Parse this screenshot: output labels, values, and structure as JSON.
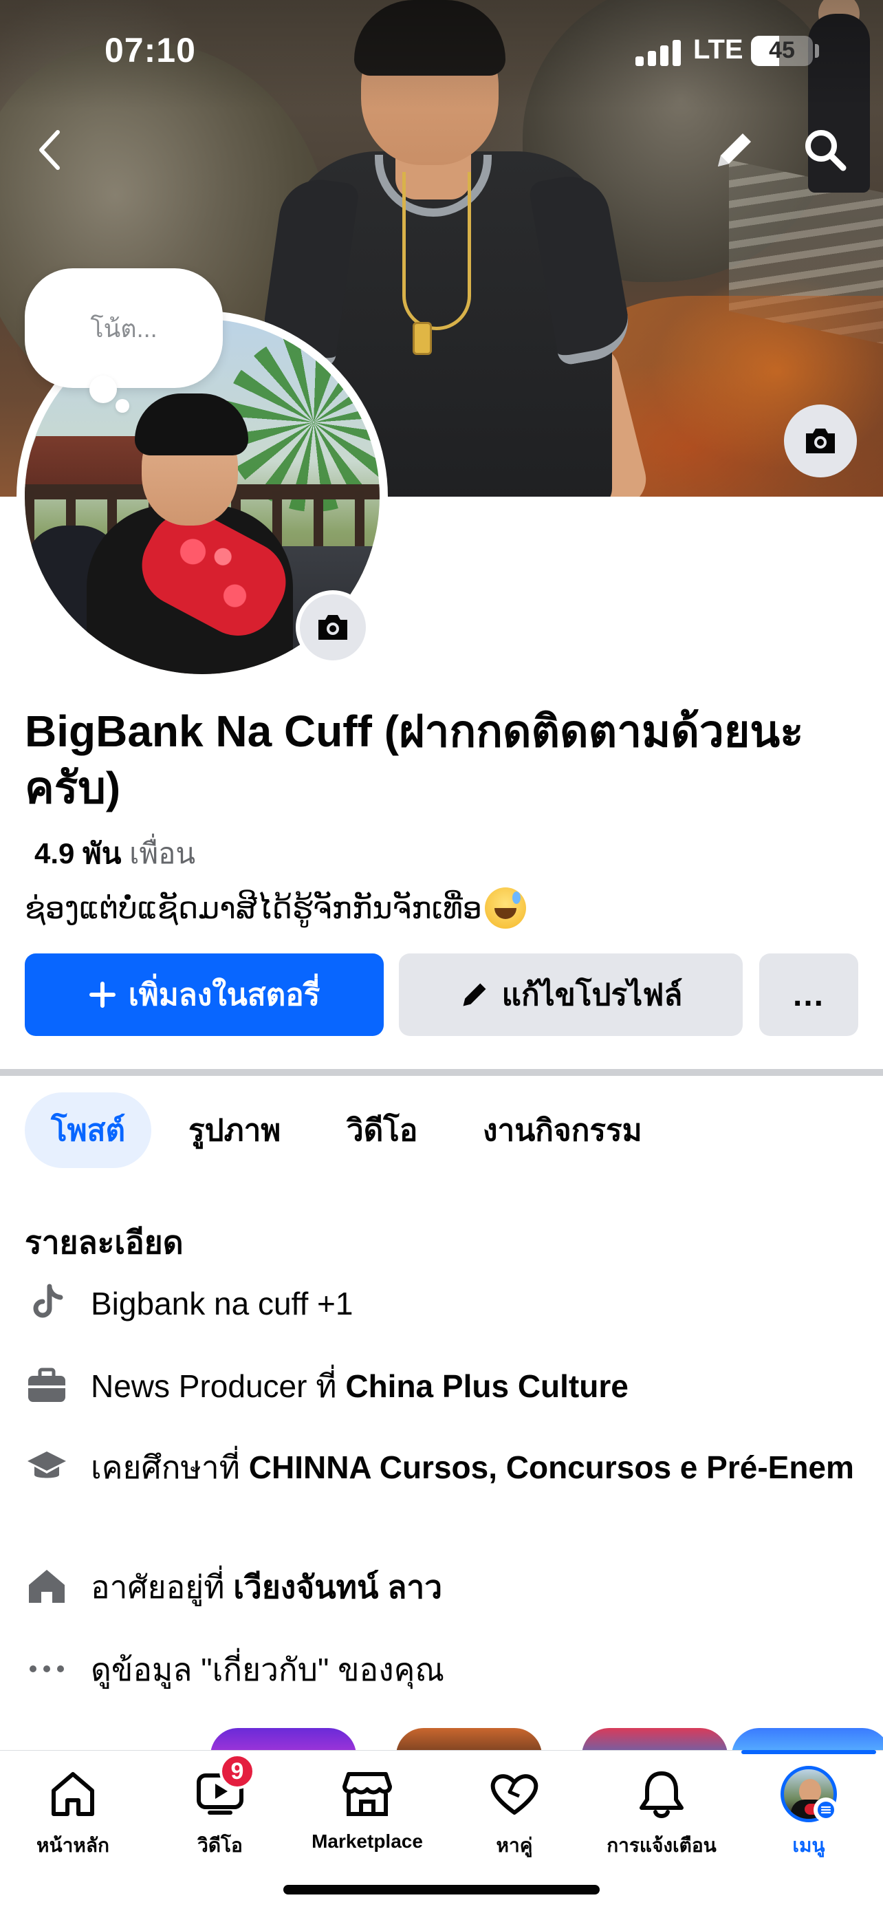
{
  "status_bar": {
    "time": "07:10",
    "network": "LTE",
    "battery": "45"
  },
  "header": {
    "back_icon": "chevron-left-icon",
    "edit_icon": "pencil-icon",
    "search_icon": "search-icon",
    "cover_camera_icon": "camera-icon"
  },
  "note": {
    "placeholder": "โน้ต..."
  },
  "profile": {
    "name": "BigBank Na Cuff (ฝากกดติดตามด้วยนะครับ)",
    "friends_count": "4.9 พัน",
    "friends_label": "เพื่อน",
    "bio": "ຊ່ອງແຕ່ບໍ່ແຊັດມາສີໄດ້ຮູ້ຈັກກັນຈັກເທື່ອ",
    "bio_emoji": "grinning-face-with-sweat-icon"
  },
  "actions": {
    "add_story": "เพิ่มลงในสตอรี่",
    "edit_profile": "แก้ไขโปรไฟล์",
    "more": "..."
  },
  "tabs": [
    {
      "label": "โพสต์",
      "active": true
    },
    {
      "label": "รูปภาพ",
      "active": false
    },
    {
      "label": "วิดีโอ",
      "active": false
    },
    {
      "label": "งานกิจกรรม",
      "active": false
    }
  ],
  "details": {
    "title": "รายละเอียด",
    "tiktok": {
      "icon": "tiktok-icon",
      "text": "Bigbank na cuff +1"
    },
    "work": {
      "icon": "briefcase-icon",
      "prefix": "News Producer ที่ ",
      "place": "China Plus Culture"
    },
    "education": {
      "icon": "graduation-cap-icon",
      "prefix": "เคยศึกษาที่ ",
      "place": "CHINNA Cursos, Concursos e Pré-Enem"
    },
    "home": {
      "icon": "house-icon",
      "prefix": "อาศัยอยู่ที่ ",
      "place": "เวียงจันทน์ ลาว"
    },
    "about": {
      "icon": "ellipsis-icon",
      "text": "ดูข้อมูล \"เกี่ยวกับ\" ของคุณ"
    }
  },
  "bottom_nav": {
    "items": [
      {
        "label": "หน้าหลัก",
        "icon": "home-icon"
      },
      {
        "label": "วิดีโอ",
        "icon": "video-icon",
        "badge": "9"
      },
      {
        "label": "Marketplace",
        "icon": "shop-icon"
      },
      {
        "label": "หาคู่",
        "icon": "heart-icon"
      },
      {
        "label": "การแจ้งเตือน",
        "icon": "bell-icon"
      },
      {
        "label": "เมนู",
        "icon": "avatar-menu-icon",
        "active": true
      }
    ]
  },
  "colors": {
    "accent": "#0866ff",
    "badge": "#e41e3f",
    "secondary_button": "#e4e6eb",
    "muted_text": "#65676b"
  }
}
